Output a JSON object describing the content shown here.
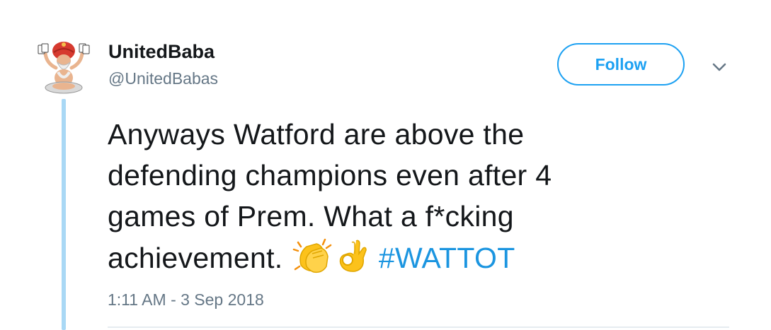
{
  "user": {
    "display_name": "UnitedBaba",
    "handle": "@UnitedBabas"
  },
  "header": {
    "follow_label": "Follow",
    "caret_icon": "chevron-down-icon"
  },
  "tweet": {
    "lines": [
      "Anyways Watford are above the",
      "defending champions even after 4",
      "games of Prem. What a f*cking",
      "achievement."
    ],
    "emojis": [
      "clapping-hands-icon",
      "ok-hand-icon"
    ],
    "hashtag": "#WATTOT",
    "timestamp": "1:11 AM - 3 Sep 2018"
  },
  "colors": {
    "accent": "#1da1f2",
    "hashtag": "#1b95e0",
    "text": "#14171a",
    "secondary_text": "#657786",
    "thread_line": "#a9d8f5",
    "emoji": "#fcc21b"
  }
}
